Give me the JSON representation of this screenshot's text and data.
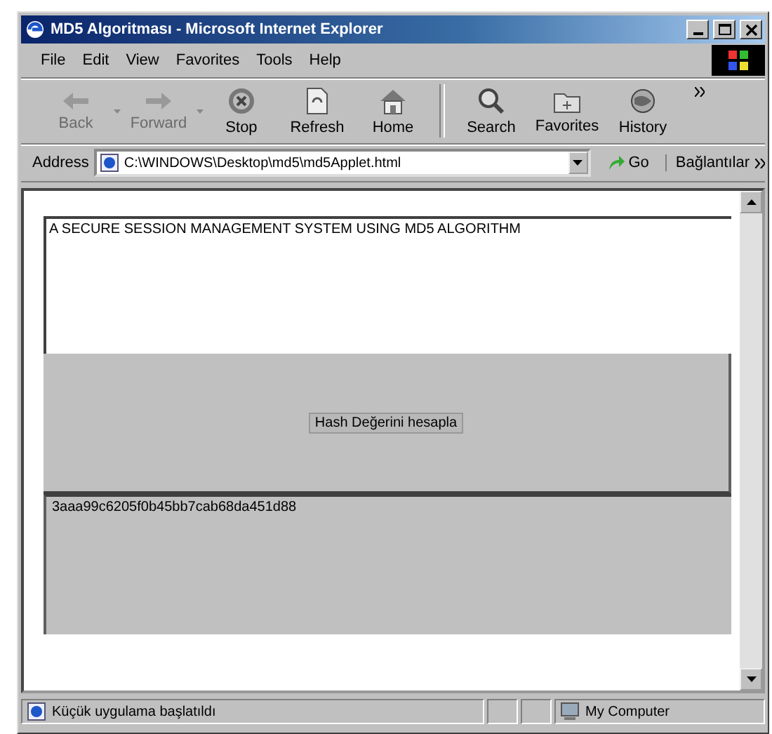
{
  "window": {
    "title": "MD5 Algoritması - Microsoft Internet Explorer"
  },
  "menu": [
    {
      "label": "File"
    },
    {
      "label": "Edit"
    },
    {
      "label": "View"
    },
    {
      "label": "Favorites"
    },
    {
      "label": "Tools"
    },
    {
      "label": "Help"
    }
  ],
  "toolbar": [
    {
      "kind": "back",
      "label": "Back",
      "disabled": true
    },
    {
      "kind": "forward",
      "label": "Forward",
      "disabled": true
    },
    {
      "kind": "stop",
      "label": "Stop",
      "disabled": false
    },
    {
      "kind": "refresh",
      "label": "Refresh",
      "disabled": false
    },
    {
      "kind": "home",
      "label": "Home",
      "disabled": false
    },
    {
      "kind": "search",
      "label": "Search",
      "disabled": false
    },
    {
      "kind": "favorites",
      "label": "Favorites",
      "disabled": false
    },
    {
      "kind": "history",
      "label": "History",
      "disabled": false
    }
  ],
  "address": {
    "label": "Address",
    "value": "C:\\WINDOWS\\Desktop\\md5\\md5Applet.html",
    "go": "Go",
    "links": "Bağlantılar"
  },
  "applet": {
    "heading": "A SECURE SESSION MANAGEMENT SYSTEM USING MD5 ALGORITHM",
    "button": "Hash Değerini hesapla",
    "output": "3aaa99c6205f0b45bb7cab68da451d88"
  },
  "status_bar": {
    "message": "Küçük uygulama başlatıldı",
    "zone": "My Computer"
  }
}
